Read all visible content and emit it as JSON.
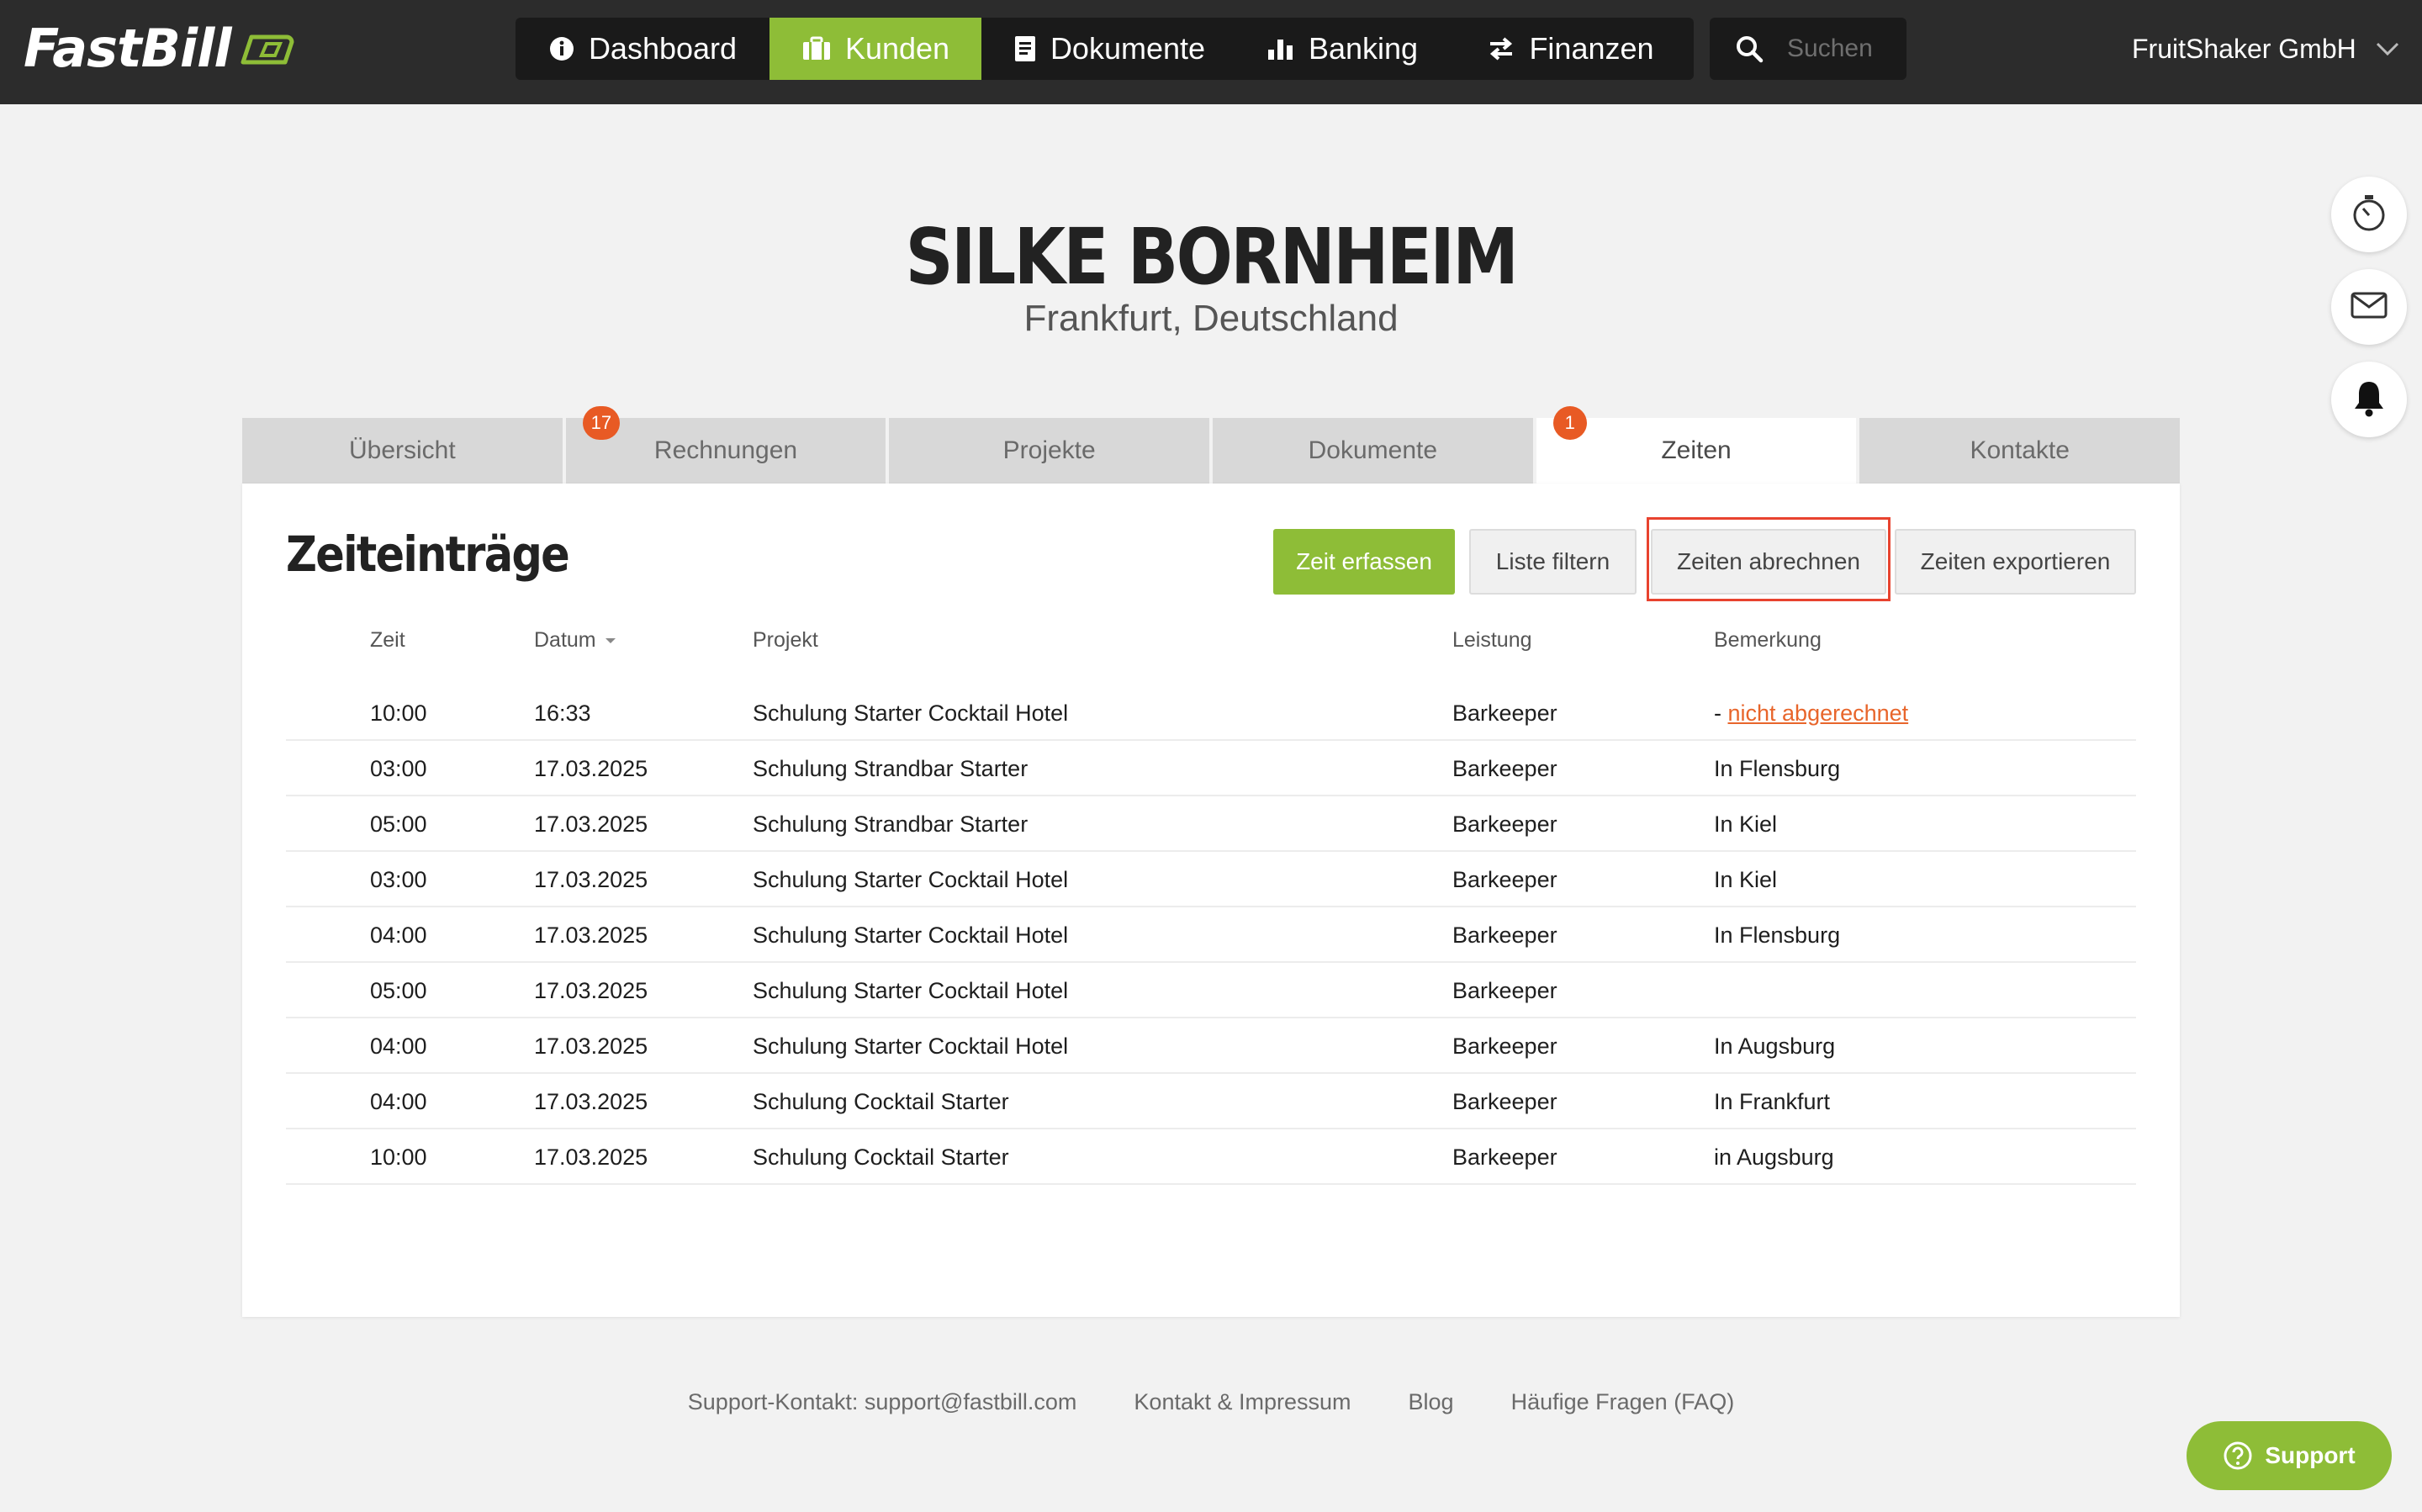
{
  "app": {
    "logo_text": "FastBill",
    "company_name": "FruitShaker GmbH",
    "accent_color": "#8ebd37",
    "alert_color": "#e85a24"
  },
  "nav": {
    "items": [
      {
        "label": "Dashboard",
        "icon": "info-icon"
      },
      {
        "label": "Kunden",
        "icon": "briefcase-icon",
        "active": true
      },
      {
        "label": "Dokumente",
        "icon": "document-icon"
      },
      {
        "label": "Banking",
        "icon": "bar-chart-icon"
      },
      {
        "label": "Finanzen",
        "icon": "transfer-arrows-icon"
      }
    ],
    "search_placeholder": "Suchen"
  },
  "side_buttons": [
    "stopwatch-icon",
    "mail-icon",
    "bell-icon"
  ],
  "customer": {
    "name": "SILKE BORNHEIM",
    "location": "Frankfurt, Deutschland"
  },
  "tabs": [
    {
      "label": "Übersicht"
    },
    {
      "label": "Rechnungen",
      "badge": "17"
    },
    {
      "label": "Projekte"
    },
    {
      "label": "Dokumente"
    },
    {
      "label": "Zeiten",
      "badge": "1",
      "active": true
    },
    {
      "label": "Kontakte"
    }
  ],
  "panel": {
    "title": "Zeiteinträge",
    "buttons": {
      "add": "Zeit erfassen",
      "filter": "Liste filtern",
      "bill": "Zeiten abrechnen",
      "export": "Zeiten exportieren"
    }
  },
  "table": {
    "headers": {
      "zeit": "Zeit",
      "datum": "Datum",
      "projekt": "Projekt",
      "leistung": "Leistung",
      "bemerkung": "Bemerkung"
    },
    "rows": [
      {
        "zeit": "10:00",
        "datum": "16:33",
        "projekt": "Schulung Starter Cocktail Hotel",
        "leistung": "Barkeeper",
        "bemerkung_prefix": "- ",
        "bemerkung_link": "nicht abgerechnet"
      },
      {
        "zeit": "03:00",
        "datum": "17.03.2025",
        "projekt": "Schulung Strandbar Starter",
        "leistung": "Barkeeper",
        "bemerkung": "In Flensburg"
      },
      {
        "zeit": "05:00",
        "datum": "17.03.2025",
        "projekt": "Schulung Strandbar Starter",
        "leistung": "Barkeeper",
        "bemerkung": "In Kiel"
      },
      {
        "zeit": "03:00",
        "datum": "17.03.2025",
        "projekt": "Schulung Starter Cocktail Hotel",
        "leistung": "Barkeeper",
        "bemerkung": "In Kiel"
      },
      {
        "zeit": "04:00",
        "datum": "17.03.2025",
        "projekt": "Schulung Starter Cocktail Hotel",
        "leistung": "Barkeeper",
        "bemerkung": "In Flensburg"
      },
      {
        "zeit": "05:00",
        "datum": "17.03.2025",
        "projekt": "Schulung Starter Cocktail Hotel",
        "leistung": "Barkeeper",
        "bemerkung": ""
      },
      {
        "zeit": "04:00",
        "datum": "17.03.2025",
        "projekt": "Schulung Starter Cocktail Hotel",
        "leistung": "Barkeeper",
        "bemerkung": "In Augsburg"
      },
      {
        "zeit": "04:00",
        "datum": "17.03.2025",
        "projekt": "Schulung Cocktail Starter",
        "leistung": "Barkeeper",
        "bemerkung": "In Frankfurt"
      },
      {
        "zeit": "10:00",
        "datum": "17.03.2025",
        "projekt": "Schulung Cocktail Starter",
        "leistung": "Barkeeper",
        "bemerkung": "in Augsburg"
      }
    ]
  },
  "footer": {
    "support_contact": "Support-Kontakt: support@fastbill.com",
    "imprint": "Kontakt & Impressum",
    "blog": "Blog",
    "faq": "Häufige Fragen (FAQ)"
  },
  "support_button": {
    "label": "Support",
    "icon": "help-circle-icon"
  }
}
